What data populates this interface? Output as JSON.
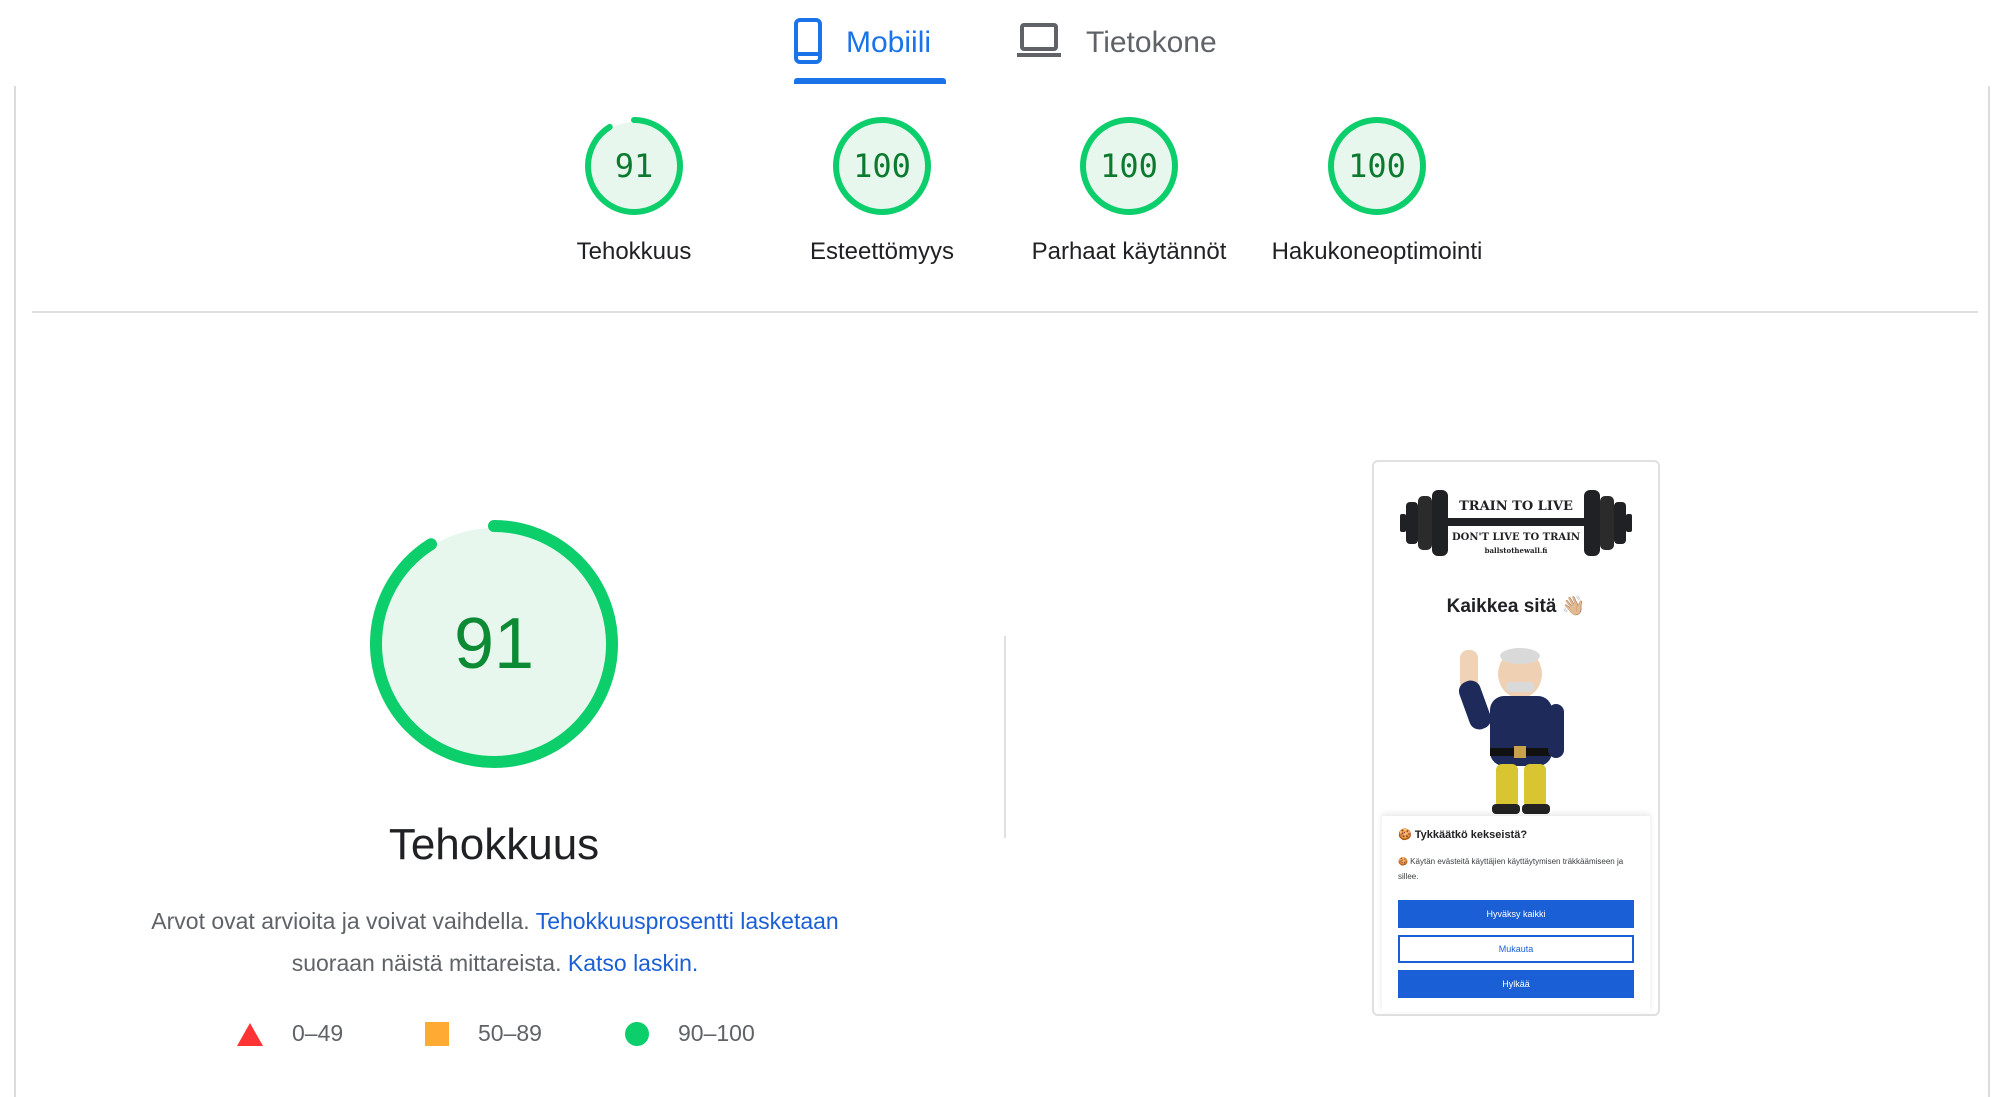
{
  "tabs": {
    "mobile_label": "Mobiili",
    "desktop_label": "Tietokone",
    "active": "mobile"
  },
  "scores": [
    {
      "label": "Tehokkuus",
      "value": "91",
      "fraction": 0.91
    },
    {
      "label": "Esteettömyys",
      "value": "100",
      "fraction": 1.0
    },
    {
      "label": "Parhaat käytännöt",
      "value": "100",
      "fraction": 1.0
    },
    {
      "label": "Hakukoneoptimointi",
      "value": "100",
      "fraction": 1.0
    }
  ],
  "main": {
    "score_value": "91",
    "score_fraction": 0.91,
    "title": "Tehokkuus",
    "desc_text1": "Arvot ovat arvioita ja voivat vaihdella.",
    "desc_link1": "Tehokkuusprosentti lasketaan",
    "desc_text2": "suoraan näistä mittareista.",
    "desc_link2": "Katso laskin."
  },
  "legend": {
    "red": "0–49",
    "orange": "50–89",
    "green": "90–100"
  },
  "colors": {
    "accent": "#1a73e8",
    "pass_stroke": "#0cce6b",
    "pass_fill": "#e8f7ee",
    "pass_text": "#0c7a2e",
    "fail": "#ff3333",
    "average": "#ffaa33"
  },
  "thumbnail": {
    "logo_line1": "TRAIN TO LIVE",
    "logo_line2": "DON'T LIVE TO TRAIN",
    "logo_url": "ballstothewall.fi",
    "heading": "Kaikkea sitä 👋🏼",
    "cookie_title": "🍪 Tykkäätkö kekseistä?",
    "cookie_text": "🍪 Käytän evästeitä käyttäjien käyttäytymisen träkkäämiseen ja sillee.",
    "btn_accept": "Hyväksy kaikki",
    "btn_customize": "Mukauta",
    "btn_reject": "Hylkää"
  }
}
